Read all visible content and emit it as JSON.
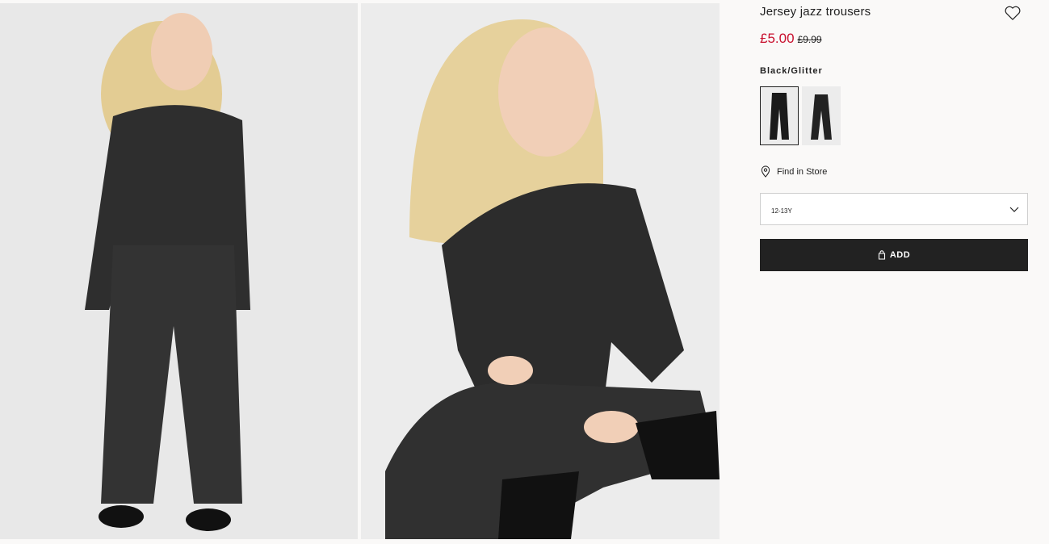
{
  "product": {
    "title": "Jersey jazz trousers",
    "sale_price": "£5.00",
    "original_price": "£9.99",
    "color_name": "Black/Glitter",
    "sale_color": "#c8102e"
  },
  "gallery": {
    "images": [
      {
        "icon": "girl-standing-photo"
      },
      {
        "icon": "girl-sitting-photo"
      }
    ]
  },
  "swatches": [
    {
      "icon": "trousers-thumbnail",
      "selected": true
    },
    {
      "icon": "trousers-thumbnail",
      "selected": false
    }
  ],
  "store": {
    "label": "Find in Store",
    "icon": "location-pin-icon"
  },
  "size_select": {
    "value": "12-13Y",
    "icon": "chevron-down-icon"
  },
  "add_button": {
    "label": "ADD",
    "icon": "bag-icon"
  },
  "favourite": {
    "icon": "heart-icon"
  }
}
